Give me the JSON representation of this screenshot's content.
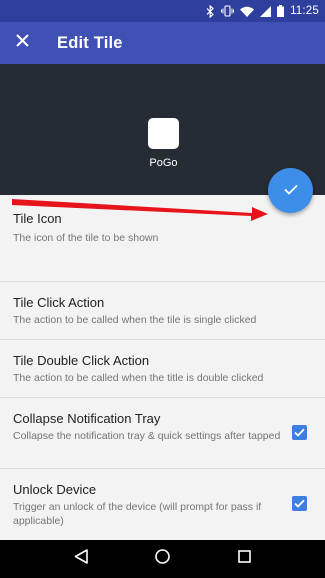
{
  "status_bar": {
    "time": "11:25",
    "icons": [
      "bluetooth-icon",
      "vibrate-icon",
      "wifi-icon",
      "signal-icon",
      "battery-icon"
    ]
  },
  "toolbar": {
    "title": "Edit Tile",
    "close_icon": "close-icon"
  },
  "preview": {
    "tile_label": "PoGo"
  },
  "fab": {
    "icon": "check-icon",
    "color": "#3d8ee9"
  },
  "annotation": {
    "arrow_color": "#e8141b"
  },
  "settings": [
    {
      "title": "Tile Icon",
      "subtitle": "The icon of the tile to be shown"
    },
    {
      "title": "Tile Click Action",
      "subtitle": "The action to be called when the tile is single clicked"
    },
    {
      "title": "Tile Double Click Action",
      "subtitle": "The action to be called when the title is double clicked"
    },
    {
      "title": "Collapse Notification Tray",
      "subtitle": "Collapse the notification tray & quick settings after tapped",
      "checked": true
    },
    {
      "title": "Unlock Device",
      "subtitle": "Trigger an unlock of the device (will prompt for pass if applicable)",
      "checked": true
    }
  ],
  "nav_bar": {
    "buttons": [
      "back-icon",
      "home-icon",
      "recents-icon"
    ]
  },
  "colors": {
    "toolbar": "#3f51b5",
    "status_bar": "#2f3f9e",
    "preview_bg": "#262c33",
    "checkbox": "#3d7fe0"
  }
}
